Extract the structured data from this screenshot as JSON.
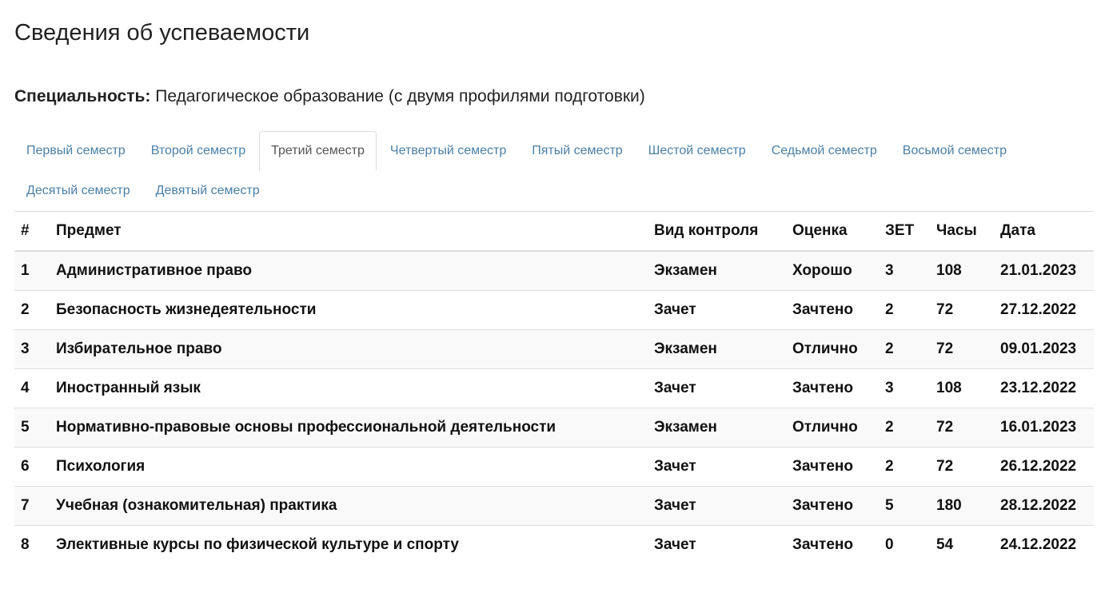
{
  "page": {
    "title": "Сведения об успеваемости"
  },
  "specialty": {
    "label": "Специальность:",
    "value": "Педагогическое образование (с двумя профилями подготовки)"
  },
  "tabs": [
    {
      "label": "Первый семестр",
      "active": false
    },
    {
      "label": "Второй семестр",
      "active": false
    },
    {
      "label": "Третий семестр",
      "active": true
    },
    {
      "label": "Четвертый семестр",
      "active": false
    },
    {
      "label": "Пятый семестр",
      "active": false
    },
    {
      "label": "Шестой семестр",
      "active": false
    },
    {
      "label": "Седьмой семестр",
      "active": false
    },
    {
      "label": "Восьмой семестр",
      "active": false
    },
    {
      "label": "Десятый семестр",
      "active": false
    },
    {
      "label": "Девятый семестр",
      "active": false
    }
  ],
  "table": {
    "headers": {
      "num": "#",
      "subject": "Предмет",
      "control": "Вид контроля",
      "grade": "Оценка",
      "zet": "ЗЕТ",
      "hours": "Часы",
      "date": "Дата"
    },
    "rows": [
      {
        "num": "1",
        "subject": "Административное право",
        "control": "Экзамен",
        "grade": "Хорошо",
        "zet": "3",
        "hours": "108",
        "date": "21.01.2023"
      },
      {
        "num": "2",
        "subject": "Безопасность жизнедеятельности",
        "control": "Зачет",
        "grade": "Зачтено",
        "zet": "2",
        "hours": "72",
        "date": "27.12.2022"
      },
      {
        "num": "3",
        "subject": "Избирательное право",
        "control": "Экзамен",
        "grade": "Отлично",
        "zet": "2",
        "hours": "72",
        "date": "09.01.2023"
      },
      {
        "num": "4",
        "subject": "Иностранный язык",
        "control": "Зачет",
        "grade": "Зачтено",
        "zet": "3",
        "hours": "108",
        "date": "23.12.2022"
      },
      {
        "num": "5",
        "subject": "Нормативно-правовые основы профессиональной деятельности",
        "control": "Экзамен",
        "grade": "Отлично",
        "zet": "2",
        "hours": "72",
        "date": "16.01.2023"
      },
      {
        "num": "6",
        "subject": "Психология",
        "control": "Зачет",
        "grade": "Зачтено",
        "zet": "2",
        "hours": "72",
        "date": "26.12.2022"
      },
      {
        "num": "7",
        "subject": "Учебная (ознакомительная) практика",
        "control": "Зачет",
        "grade": "Зачтено",
        "zet": "5",
        "hours": "180",
        "date": "28.12.2022"
      },
      {
        "num": "8",
        "subject": "Элективные курсы по физической культуре и спорту",
        "control": "Зачет",
        "grade": "Зачтено",
        "zet": "0",
        "hours": "54",
        "date": "24.12.2022"
      }
    ]
  },
  "colors": {
    "link": "#4a7fa7",
    "border": "#dddddd",
    "stripe": "#f9f9f9"
  }
}
